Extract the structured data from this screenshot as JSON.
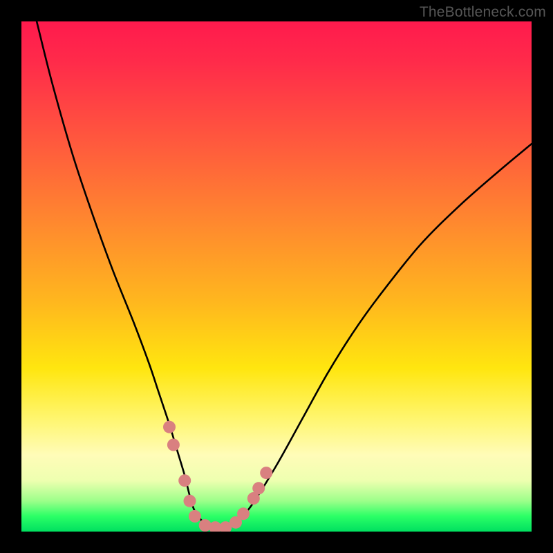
{
  "watermark": {
    "text": "TheBottleneck.com"
  },
  "chart_data": {
    "type": "line",
    "title": "",
    "xlabel": "",
    "ylabel": "",
    "xlim": [
      0,
      100
    ],
    "ylim": [
      0,
      100
    ],
    "grid": false,
    "legend": false,
    "series": [
      {
        "name": "curve",
        "color": "#000000",
        "x": [
          3,
          6,
          10,
          14,
          18,
          22,
          25,
          27,
          29,
          30.5,
          32,
          33,
          34,
          36,
          38,
          40,
          42,
          45,
          50,
          55,
          60,
          65,
          70,
          78,
          86,
          94,
          100
        ],
        "y": [
          100,
          88,
          74,
          62,
          51,
          41,
          33,
          27,
          21,
          16,
          11,
          7,
          4,
          1.5,
          0.8,
          0.8,
          1.8,
          5,
          13,
          22,
          31,
          39,
          46,
          56,
          64,
          71,
          76
        ]
      },
      {
        "name": "markers",
        "color": "#d98080",
        "points": [
          {
            "x": 29.0,
            "y": 20.5
          },
          {
            "x": 29.8,
            "y": 17.0
          },
          {
            "x": 32.0,
            "y": 10.0
          },
          {
            "x": 33.0,
            "y": 6.0
          },
          {
            "x": 34.0,
            "y": 3.0
          },
          {
            "x": 36.0,
            "y": 1.2
          },
          {
            "x": 38.0,
            "y": 0.8
          },
          {
            "x": 40.0,
            "y": 0.8
          },
          {
            "x": 42.0,
            "y": 1.8
          },
          {
            "x": 43.5,
            "y": 3.5
          },
          {
            "x": 45.5,
            "y": 6.5
          },
          {
            "x": 46.5,
            "y": 8.5
          },
          {
            "x": 48.0,
            "y": 11.5
          }
        ]
      }
    ]
  }
}
